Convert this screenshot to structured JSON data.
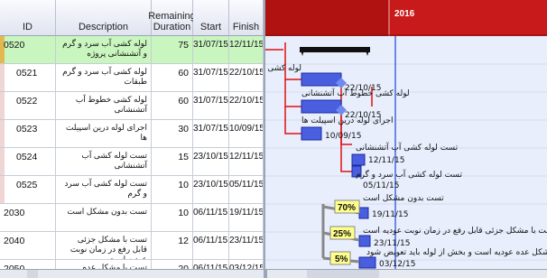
{
  "columns": {
    "id": "ID",
    "description": "Description",
    "duration": "Remaining\nDuration",
    "start": "Start",
    "finish": "Finish"
  },
  "rows": [
    {
      "id": "0520",
      "description": "لوله کشی آب سرد و گرم و آتشنشانی پروژه",
      "duration": "75",
      "start": "31/07/15",
      "finish": "12/11/15"
    },
    {
      "id": "0521",
      "description": "لوله کشی آب سرد و گرم طبقات",
      "duration": "60",
      "start": "31/07/15",
      "finish": "22/10/15"
    },
    {
      "id": "0522",
      "description": "لوله کشی خطوط آب آتشنشانی",
      "duration": "60",
      "start": "31/07/15",
      "finish": "22/10/15"
    },
    {
      "id": "0523",
      "description": "اجرای لوله درین اسپیلت ها",
      "duration": "30",
      "start": "31/07/15",
      "finish": "10/09/15"
    },
    {
      "id": "0524",
      "description": "تست لوله کشی آب آتشنشانی",
      "duration": "15",
      "start": "23/10/15",
      "finish": "12/11/15"
    },
    {
      "id": "0525",
      "description": "تست لوله کشی آب سرد و گرم",
      "duration": "10",
      "start": "23/10/15",
      "finish": "05/11/15"
    },
    {
      "id": "2030",
      "description": "تست بدون مشکل است",
      "duration": "10",
      "start": "06/11/15",
      "finish": "19/11/15"
    },
    {
      "id": "2040",
      "description": "تست با مشکل جزئی قابل رفع در زمان نوبت عودیه است",
      "duration": "12",
      "start": "06/11/15",
      "finish": "23/11/15"
    },
    {
      "id": "2050",
      "description": "تست با مشکل عده عودیه است و بخش از لوله باید تعویض شود",
      "duration": "20",
      "start": "06/11/15",
      "finish": "03/12/15"
    }
  ],
  "timeline": {
    "year": "2016"
  },
  "bars": [
    {
      "label": "لوله کشی آب سرد و گرم طبقات",
      "date": "22/10/15"
    },
    {
      "label": "لوله کشی خطوط آب آتشنشانی",
      "date": "22/10/15"
    },
    {
      "label": "اجرای لوله درین اسپیلت ها",
      "date": "10/09/15"
    },
    {
      "label": "تست لوله کشی آب آتشنشانی",
      "date": "12/11/15"
    },
    {
      "label": "تست لوله کشی آب سرد و گرم",
      "date": "05/11/15"
    },
    {
      "label": "تست بدون مشکل است",
      "date": "19/11/15"
    },
    {
      "label": "تست با مشکل جزئی قابل رفع در زمان نوبت عودیه است",
      "date": "23/11/15"
    },
    {
      "label": "تست با مشکل عده عودیه است و بخش از لوله باید تعویض شود",
      "date": "03/12/15"
    }
  ],
  "probabilities": [
    "70%",
    "25%",
    "5%"
  ],
  "colors": {
    "summary_row": "#c9f5bf",
    "bar": "#4a5fe0",
    "link": "#e01010",
    "timeline_header": "#c81a1a",
    "chart_bg": "#e8eefc"
  }
}
